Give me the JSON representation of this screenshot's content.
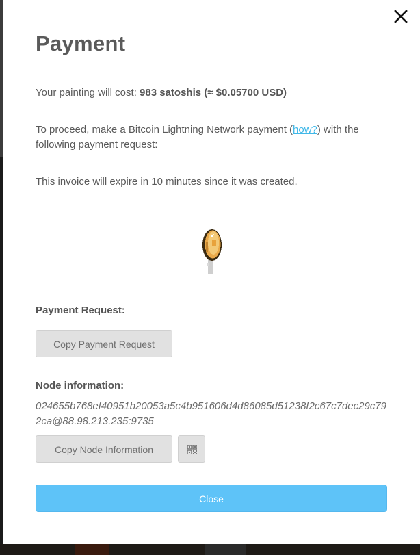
{
  "modal": {
    "title": "Payment",
    "cost": {
      "prefix": "Your painting will cost: ",
      "amount": "983 satoshis (≈ $0.05700 USD)"
    },
    "proceed": {
      "before": "To proceed, make a Bitcoin Lightning Network payment (",
      "link": "how?",
      "after": ") with the following payment request:"
    },
    "expire_text": "This invoice will expire in 10 minutes since it was created.",
    "payment_request_label": "Payment Request:",
    "copy_payment_request_label": "Copy Payment Request",
    "node_information_label": "Node information:",
    "node_information": "024655b768ef40951b20053a5c4b951606d4d86085d51238f2c67c7dec29c792ca@88.98.213.235:9735",
    "copy_node_information_label": "Copy Node Information",
    "close_label": "Close"
  },
  "icons": {
    "close": "close-icon",
    "loading": "spinning-coin-icon",
    "qr": "qr-code-icon"
  },
  "colors": {
    "accent": "#5ec3f8",
    "link": "#41b8e8",
    "text": "#5a5a5a",
    "button_gray": "#e1e1e1"
  }
}
